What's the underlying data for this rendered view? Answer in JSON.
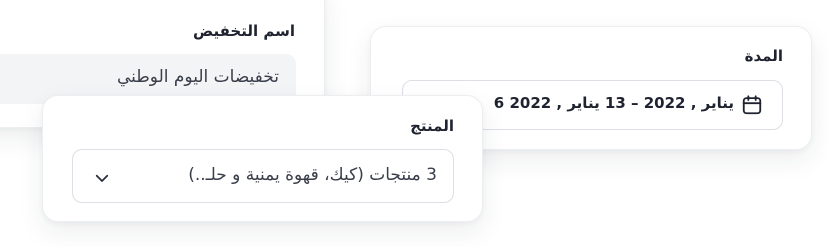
{
  "discount_name": {
    "label": "اسم التخفيض",
    "value": "تخفيضات اليوم الوطني"
  },
  "duration": {
    "label": "المدة",
    "value": "6 يناير , 2022 – 13 يناير , 2022",
    "icon": "calendar-icon"
  },
  "product": {
    "label": "المنتج",
    "selected_value": "3 منتجات (كيك، قهوة يمنية و حلـ..)",
    "icon": "chevron-down-icon"
  },
  "colors": {
    "text": "#1f2330",
    "field_fill": "#f3f4f6",
    "field_border": "#dcdfe4",
    "card_border": "#eceef1"
  }
}
